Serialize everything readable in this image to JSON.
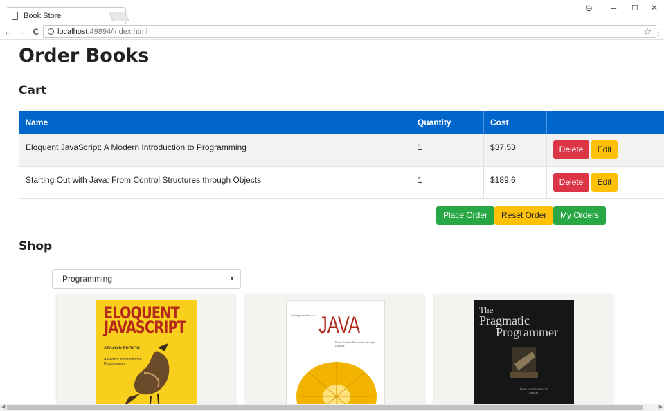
{
  "browser": {
    "tab_title": "Book Store",
    "tab_close": "×",
    "url_host": "localhost",
    "url_path": ":49894/index.html",
    "back": "←",
    "forward": "→",
    "reload": "C",
    "star": "☆",
    "menu": "⋮",
    "profile": "⊖",
    "minimize": "–",
    "maximize": "☐",
    "close": "✕"
  },
  "page": {
    "title": "Order Books",
    "cart_heading": "Cart",
    "shop_heading": "Shop"
  },
  "cart": {
    "columns": [
      "Name",
      "Quantity",
      "Cost",
      ""
    ],
    "rows": [
      {
        "name": "Eloquent JavaScript: A Modern Introduction to Programming",
        "quantity": "1",
        "cost": "$37.53",
        "delete": "Delete",
        "edit": "Edit"
      },
      {
        "name": "Starting Out with Java: From Control Structures through Objects",
        "quantity": "1",
        "cost": "$189.6",
        "delete": "Delete",
        "edit": "Edit"
      }
    ]
  },
  "order_actions": {
    "place": "Place Order",
    "reset": "Reset Order",
    "my_orders": "My Orders"
  },
  "shop": {
    "category": "Programming",
    "books": [
      {
        "cover_title": "ELOQUENT JAVASCRIPT",
        "cover_edition": "SECOND EDITION",
        "cover_sub": "A Modern Introduction to Programming"
      },
      {
        "cover_small": "starting out with >>>",
        "cover_title": "JAVA",
        "cover_sub": "From Control Structures through Objects"
      },
      {
        "cover_the": "The",
        "cover_title_1": "Pragmatic",
        "cover_title_2": "Programmer",
        "cover_sub": "from journeyman to master"
      }
    ]
  },
  "colors": {
    "table_header": "#0066cc",
    "danger": "#dc3545",
    "warning": "#ffc107",
    "success": "#28a745"
  }
}
